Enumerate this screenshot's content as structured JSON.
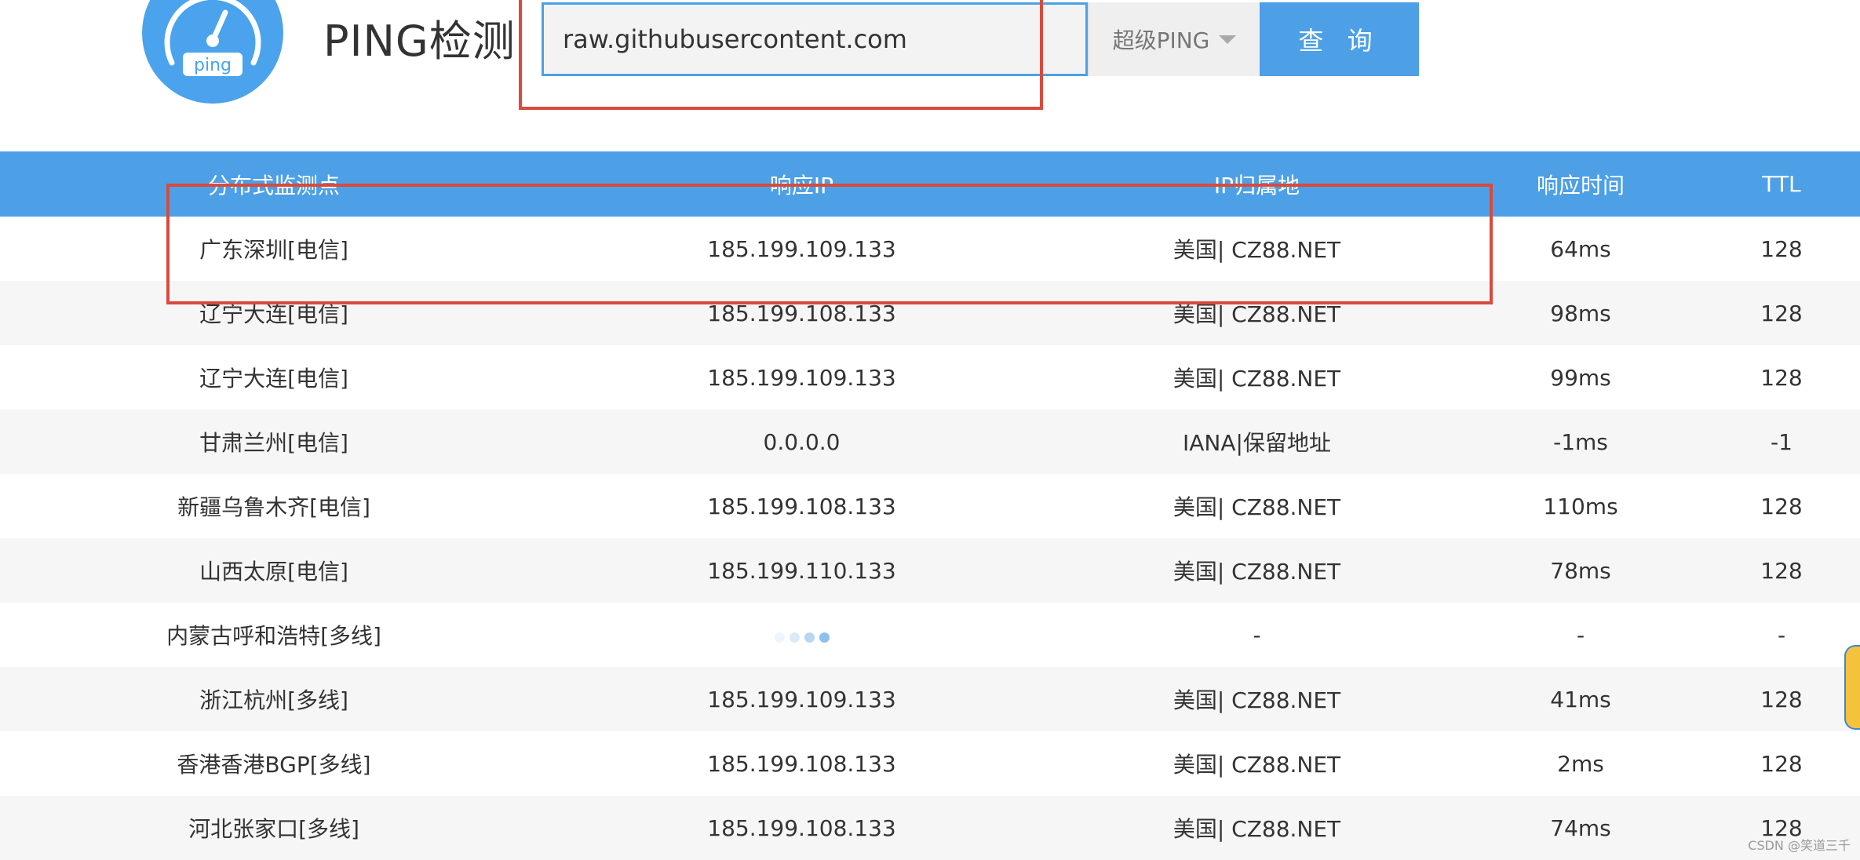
{
  "header": {
    "logo_text": "ping",
    "title": "PING检测",
    "search": {
      "value": "raw.githubusercontent.com",
      "placeholder": ""
    },
    "mode_select": {
      "selected": "超级PING",
      "icon": "chevron-down-icon"
    },
    "query_button": "查 询"
  },
  "colors": {
    "accent": "#4da0e6",
    "annotation": "#d94a3d",
    "logo": "#4aa3ec",
    "row_alt": "#f6f6f6"
  },
  "table": {
    "columns": [
      "分布式监测点",
      "响应IP",
      "IP归属地",
      "响应时间",
      "TTL"
    ],
    "rows": [
      {
        "node": "广东深圳[电信]",
        "ip": "185.199.109.133",
        "location": "美国| CZ88.NET",
        "time": "64ms",
        "ttl": "128"
      },
      {
        "node": "辽宁大连[电信]",
        "ip": "185.199.108.133",
        "location": "美国| CZ88.NET",
        "time": "98ms",
        "ttl": "128"
      },
      {
        "node": "辽宁大连[电信]",
        "ip": "185.199.109.133",
        "location": "美国| CZ88.NET",
        "time": "99ms",
        "ttl": "128"
      },
      {
        "node": "甘肃兰州[电信]",
        "ip": "0.0.0.0",
        "location": "IANA|保留地址",
        "time": "-1ms",
        "ttl": "-1"
      },
      {
        "node": "新疆乌鲁木齐[电信]",
        "ip": "185.199.108.133",
        "location": "美国| CZ88.NET",
        "time": "110ms",
        "ttl": "128"
      },
      {
        "node": "山西太原[电信]",
        "ip": "185.199.110.133",
        "location": "美国| CZ88.NET",
        "time": "78ms",
        "ttl": "128"
      },
      {
        "node": "内蒙古呼和浩特[多线]",
        "ip": "",
        "loading": true,
        "location": "-",
        "time": "-",
        "ttl": "-"
      },
      {
        "node": "浙江杭州[多线]",
        "ip": "185.199.109.133",
        "location": "美国| CZ88.NET",
        "time": "41ms",
        "ttl": "128"
      },
      {
        "node": "香港香港BGP[多线]",
        "ip": "185.199.108.133",
        "location": "美国| CZ88.NET",
        "time": "2ms",
        "ttl": "128"
      },
      {
        "node": "河北张家口[多线]",
        "ip": "185.199.108.133",
        "location": "美国| CZ88.NET",
        "time": "74ms",
        "ttl": "128"
      }
    ]
  },
  "watermark": "CSDN @笑道三千"
}
